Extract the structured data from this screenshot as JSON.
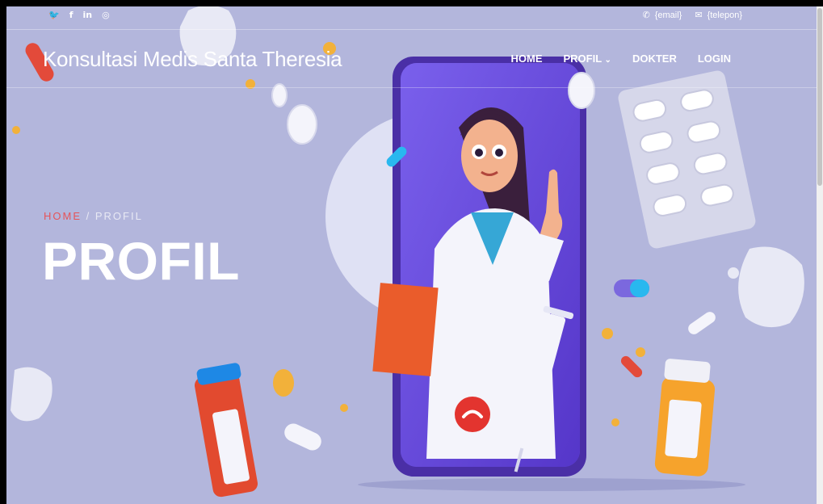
{
  "topbar": {
    "social_icons": [
      "twitter-icon",
      "facebook-icon",
      "linkedin-icon",
      "instagram-icon"
    ],
    "social_glyphs": [
      "🐦",
      "f",
      "in",
      "◎"
    ],
    "email": "{email}",
    "phone": "{telepon}"
  },
  "brand": "Konsultasi Medis Santa Theresia",
  "nav": {
    "home": "HOME",
    "profil": "PROFIL",
    "dokter": "DOKTER",
    "login": "LOGIN"
  },
  "hero": {
    "breadcrumb_home": "HOME",
    "breadcrumb_sep": " / ",
    "breadcrumb_current": "PROFIL",
    "title": "PROFIL"
  },
  "colors": {
    "background": "#b3b6dc",
    "breadcrumb_accent": "#e5545a",
    "phone": "#6a4fd8"
  }
}
